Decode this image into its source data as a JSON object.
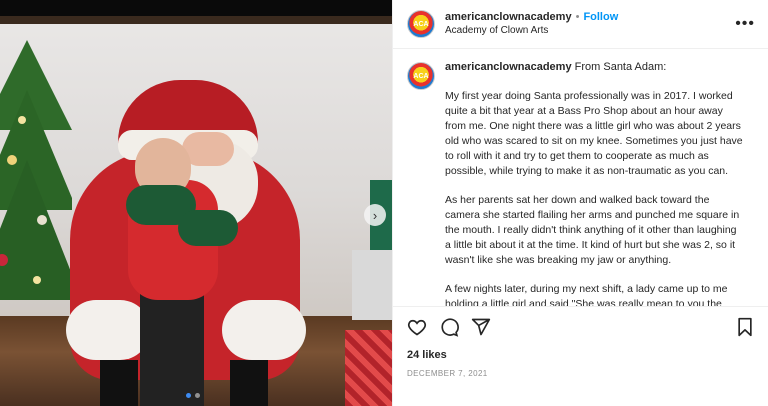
{
  "post": {
    "username": "americanclownacademy",
    "follow_label": "Follow",
    "separator": "•",
    "location": "Academy of Clown Arts",
    "avatar_text": "ACA",
    "more_label": "•••",
    "caption_intro": "From Santa Adam:",
    "paragraphs": [
      "My first year doing Santa professionally was in 2017. I worked quite a bit that year at a Bass Pro Shop about an hour away from me. One night there was a little girl who was about 2 years old who was scared to sit on my knee. Sometimes you just have to roll with it and try to get them to cooperate as much as possible, while trying to make it as non-traumatic as you can.",
      "As her parents sat her down and walked back toward the camera she started flailing her arms and punched me square in the mouth. I really didn't think anything of it other than laughing a little bit about it at the time. It kind of hurt but she was 2, so it wasn't like she was breaking my jaw or anything.",
      "A few nights later, during my next shift, a lady came up to me holding a little girl and said \"She was really mean to you the other night and we wanted to come back and apologize and we"
    ],
    "likes": "24 likes",
    "date": "DECEMBER 7, 2021"
  },
  "media": {
    "next_arrow": "›",
    "slide_count": 2,
    "active_slide": 1
  },
  "icons": {
    "like": "heart-icon",
    "comment": "comment-icon",
    "share": "send-icon",
    "save": "bookmark-icon"
  },
  "colors": {
    "follow": "#0095f6",
    "active_dot": "#3d8bf2"
  }
}
